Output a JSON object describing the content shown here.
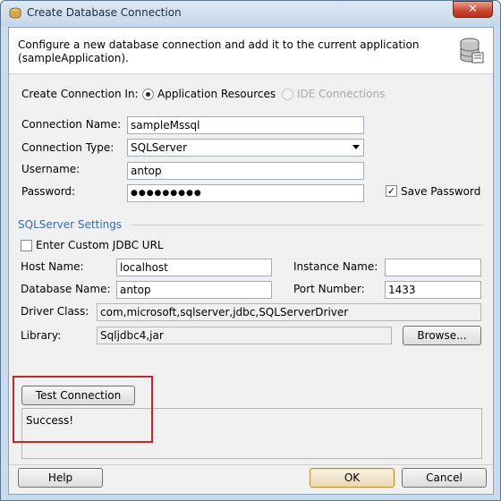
{
  "window": {
    "title": "Create Database Connection",
    "close_glyph": "✕"
  },
  "header": {
    "description": "Configure a new database connection and add it to the current application (sampleApplication)."
  },
  "create_in": {
    "label": "Create Connection In:",
    "options": [
      {
        "label": "Application Resources",
        "selected": true,
        "enabled": true
      },
      {
        "label": "IDE Connections",
        "selected": false,
        "enabled": false
      }
    ]
  },
  "form": {
    "connection_name": {
      "label": "Connection Name:",
      "value": "sampleMssql"
    },
    "connection_type": {
      "label": "Connection Type:",
      "value": "SQLServer"
    },
    "username": {
      "label": "Username:",
      "value": "antop"
    },
    "password": {
      "label": "Password:",
      "value": "●●●●●●●●●"
    },
    "save_password": {
      "label": "Save Password",
      "checked": true
    }
  },
  "settings": {
    "title": "SQLServer Settings",
    "custom_jdbc": {
      "label": "Enter Custom JDBC URL",
      "checked": false
    },
    "host_name": {
      "label": "Host Name:",
      "value": "localhost"
    },
    "instance_name": {
      "label": "Instance Name:",
      "value": ""
    },
    "database_name": {
      "label": "Database Name:",
      "value": "antop"
    },
    "port_number": {
      "label": "Port Number:",
      "value": "1433"
    },
    "driver_class": {
      "label": "Driver Class:",
      "value": "com,microsoft,sqlserver,jdbc,SQLServerDriver"
    },
    "library": {
      "label": "Library:",
      "value": "Sqljdbc4,jar"
    },
    "browse_label": "Browse..."
  },
  "test": {
    "button_label": "Test Connection",
    "result": "Success!"
  },
  "footer": {
    "help_label": "Help",
    "ok_label": "OK",
    "cancel_label": "Cancel"
  },
  "colors": {
    "accent": "#3a6ea5",
    "highlight": "#c0272d"
  }
}
